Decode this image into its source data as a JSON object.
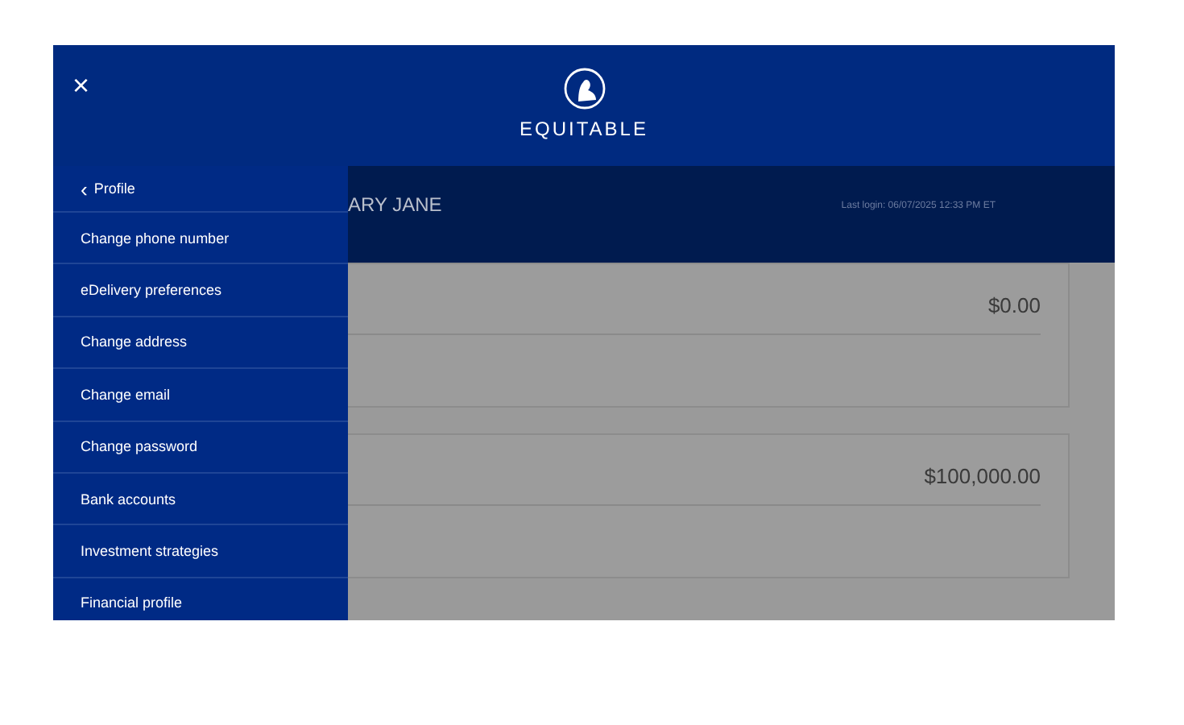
{
  "header": {
    "close_icon": "×",
    "brand": "EQUITABLE"
  },
  "sidebar": {
    "back": {
      "icon": "‹",
      "label": "Profile"
    },
    "items": [
      {
        "label": "Change phone number"
      },
      {
        "label": "eDelivery preferences"
      },
      {
        "label": "Change address"
      },
      {
        "label": "Change email"
      },
      {
        "label": "Change password"
      },
      {
        "label": "Bank accounts"
      },
      {
        "label": "Investment strategies"
      },
      {
        "label": "Financial profile"
      }
    ]
  },
  "greeting": {
    "name": "ARY JANE",
    "last_login": "Last login: 06/07/2025 12:33 PM ET"
  },
  "cards": [
    {
      "amount": "$0.00"
    },
    {
      "amount": "$100,000.00"
    }
  ]
}
